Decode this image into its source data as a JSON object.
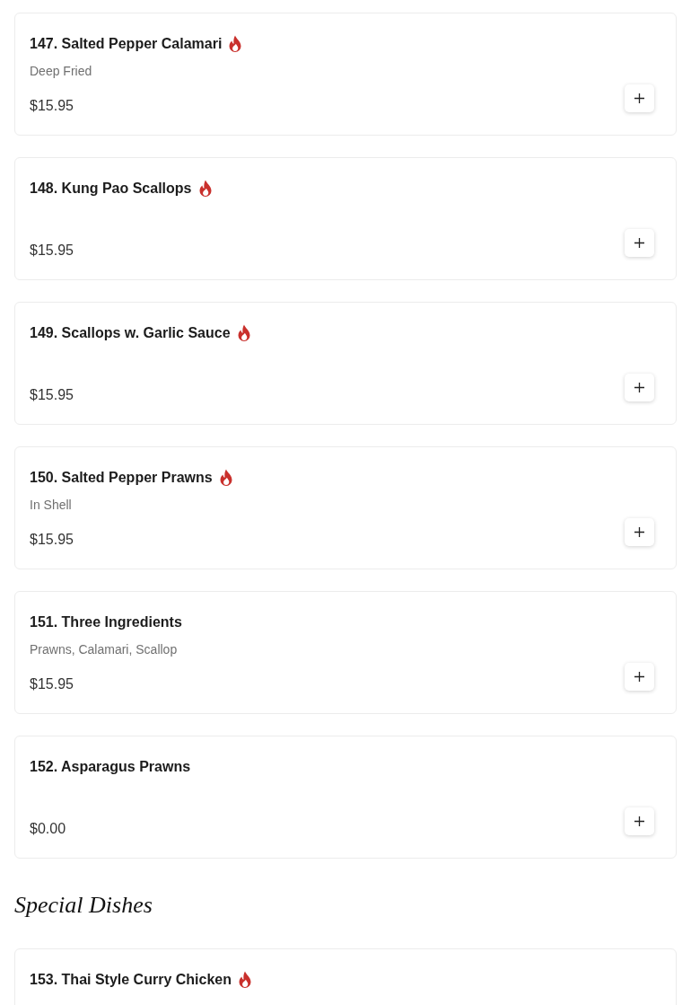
{
  "sections": [
    {
      "items": [
        {
          "title": "147. Salted Pepper Calamari",
          "spicy": true,
          "description": "Deep Fried",
          "price": "$15.95"
        },
        {
          "title": "148. Kung Pao Scallops",
          "spicy": true,
          "price": "$15.95"
        },
        {
          "title": "149. Scallops w. Garlic Sauce",
          "spicy": true,
          "price": "$15.95"
        },
        {
          "title": "150. Salted Pepper Prawns",
          "spicy": true,
          "description": "In Shell",
          "price": "$15.95"
        },
        {
          "title": "151. Three Ingredients",
          "spicy": false,
          "description": "Prawns, Calamari, Scallop",
          "price": "$15.95"
        },
        {
          "title": "152. Asparagus Prawns",
          "spicy": false,
          "price": "$0.00"
        }
      ]
    },
    {
      "heading": "Special Dishes",
      "items": [
        {
          "title": "153. Thai Style Curry Chicken",
          "spicy": true
        }
      ]
    }
  ]
}
